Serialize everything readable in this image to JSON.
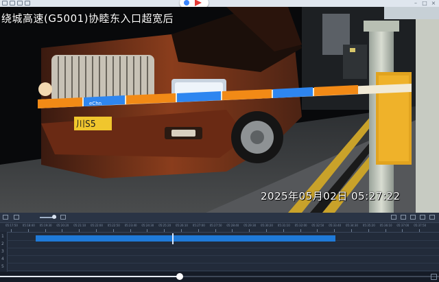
{
  "video": {
    "title_overlay": "绕城高速(G5001)协睦东入口超宽后",
    "timestamp_overlay": "2025年05月02日  05:27:22",
    "scene": {
      "license_plate": "川S5",
      "barrier_stripe_text": "eChn"
    }
  },
  "timeline": {
    "track_numbers": [
      "1",
      "2",
      "3",
      "4",
      "5"
    ],
    "tick_labels": [
      "05:17:50",
      "05:18:40",
      "05:19:30",
      "05:20:20",
      "05:21:10",
      "05:22:00",
      "05:22:50",
      "05:23:40",
      "05:24:30",
      "05:25:20",
      "05:26:10",
      "05:27:00",
      "05:27:50",
      "05:28:40",
      "05:29:30",
      "05:30:20",
      "05:31:10",
      "05:32:00",
      "05:32:50",
      "05:33:40",
      "05:34:30",
      "05:35:20",
      "05:36:10",
      "05:37:00",
      "05:37:50"
    ],
    "recording_color": "#1f7ad8"
  },
  "player": {
    "progress_fraction": 0.41
  }
}
